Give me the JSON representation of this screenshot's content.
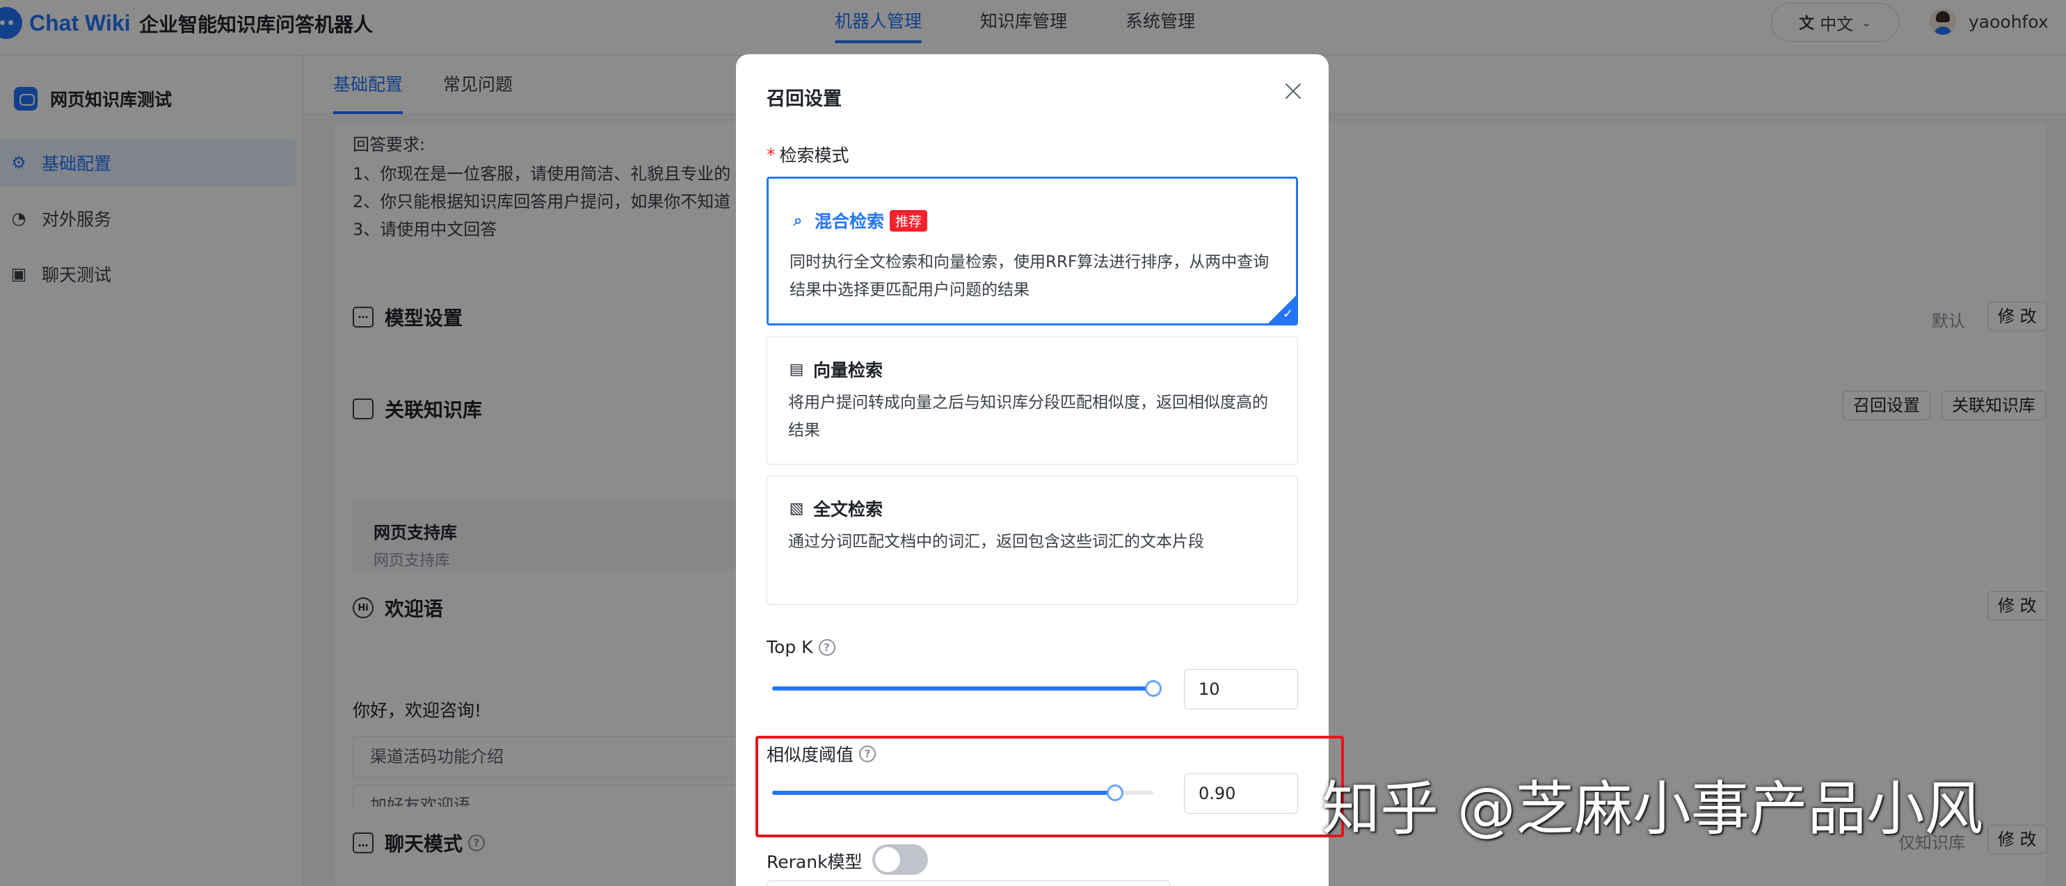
{
  "header": {
    "logo_text": "Chat Wiki",
    "app_title": "企业智能知识库问答机器人",
    "nav": [
      "机器人管理",
      "知识库管理",
      "系统管理"
    ],
    "language": "中文",
    "username": "yaoohfox"
  },
  "sidebar": {
    "robot_name": "网页知识库测试",
    "items": [
      "基础配置",
      "对外服务",
      "聊天测试"
    ]
  },
  "main": {
    "tabs": [
      "基础配置",
      "常见问题"
    ],
    "prompt_lines": [
      "回答要求:",
      "1、你现在是一位客服，请使用简洁、礼貌且专业的",
      "2、你只能根据知识库回答用户提问，如果你不知道",
      "3、请使用中文回答"
    ],
    "model_section": {
      "title": "模型设置",
      "default_label": "默认",
      "edit": "修 改"
    },
    "kb_section": {
      "title": "关联知识库",
      "recall_btn": "召回设置",
      "link_btn": "关联知识库",
      "kb_name": "网页支持库",
      "kb_sub": "网页支持库"
    },
    "welcome_section": {
      "title": "欢迎语",
      "edit": "修 改",
      "text": "你好，欢迎咨询!",
      "items": [
        "渠道活码功能介绍",
        "加好友欢迎语"
      ]
    },
    "chat_section": {
      "title": "聊天模式",
      "mode": "仅知识库",
      "edit": "修 改"
    }
  },
  "modal": {
    "title": "召回设置",
    "search_mode_label": "检索模式",
    "options": [
      {
        "title": "混合检索",
        "tag": "推荐",
        "desc": "同时执行全文检索和向量检索，使用RRF算法进行排序，从两中查询结果中选择更匹配用户问题的结果"
      },
      {
        "title": "向量检索",
        "desc": "将用户提问转成向量之后与知识库分段匹配相似度，返回相似度高的结果"
      },
      {
        "title": "全文检索",
        "desc": "通过分词匹配文档中的词汇，返回包含这些词汇的文本片段"
      }
    ],
    "topk": {
      "label": "Top K",
      "value": "10",
      "fraction": 1.0
    },
    "similarity": {
      "label": "相似度阈值",
      "value": "0.90",
      "fraction": 0.9
    },
    "rerank_label": "Rerank模型",
    "rerank_enabled": false
  },
  "watermark": "知乎 @芝麻小事产品小风",
  "colors": {
    "accent": "#2475fc",
    "tag": "#f5222d",
    "highlight": "#e4161c"
  }
}
